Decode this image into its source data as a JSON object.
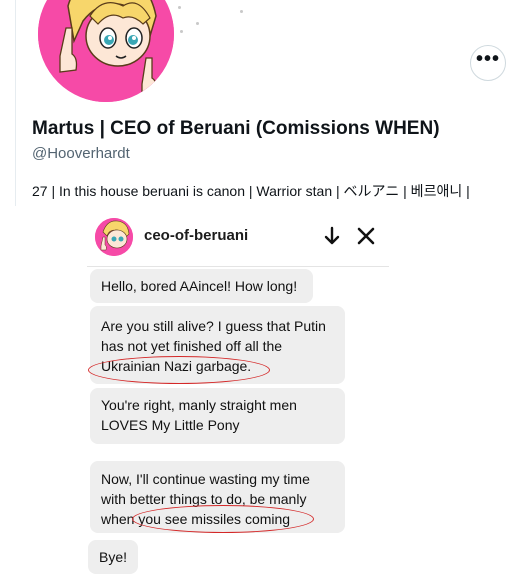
{
  "profile": {
    "display_name": "Martus | CEO of Beruani (Comissions WHEN)",
    "handle": "@Hooverhardt",
    "bio": "27 | In this house beruani is canon | Warrior stan | ベルアニ | 베르애니 |",
    "more_icon": "more-horizontal-icon",
    "more_glyph": "•••"
  },
  "chat": {
    "name": "ceo-of-beruani",
    "icons": [
      "arrow-down-icon",
      "close-icon"
    ],
    "messages": [
      {
        "text": "Hello, bored AAincel! How long!"
      },
      {
        "lines": [
          "Are you still alive? I guess that Putin",
          "has not yet finished off all the",
          "Ukrainian Nazi garbage."
        ]
      },
      {
        "lines": [
          "You're right, manly straight men",
          "LOVES My Little Pony"
        ]
      },
      {
        "lines": [
          "Now, I'll continue wasting my time",
          "with better things to do, be manly",
          "when you see missiles coming"
        ]
      },
      {
        "text": "Bye!"
      }
    ]
  },
  "colors": {
    "avatar_bg": "#f64aa7",
    "bubble_bg": "#eeeeee",
    "annotation": "#d42828",
    "handle_gray": "#536471"
  }
}
